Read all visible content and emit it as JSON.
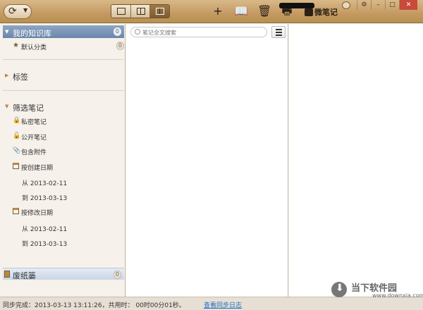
{
  "toolbar": {
    "sync_icon": "sync-icon",
    "view_modes": [
      "single-pane",
      "two-pane",
      "three-pane"
    ],
    "active_view": "three-pane",
    "actions": [
      {
        "name": "new-note-icon",
        "glyph": "+"
      },
      {
        "name": "notebook-icon",
        "glyph": "📖"
      },
      {
        "name": "trash-icon",
        "glyph": "🗑"
      },
      {
        "name": "print-icon",
        "glyph": "🖶"
      }
    ],
    "brand_text": "微笔记",
    "window_buttons": [
      "⚙",
      "–",
      "□",
      "✕"
    ]
  },
  "sidebar": {
    "kb_title": "我的知识库",
    "kb_count": "0",
    "default_category": "默认分类",
    "default_count": "0",
    "tags_title": "标签",
    "filter_title": "筛选笔记",
    "filters": {
      "private": "私密笔记",
      "public": "公开笔记",
      "attachments": "包含附件",
      "created_date": "按创建日期",
      "created_from": "从  2013-02-11",
      "created_to": "到  2013-03-13",
      "modified_date": "按修改日期",
      "modified_from": "从  2013-02-11",
      "modified_to": "到  2013-03-13"
    },
    "trash_title": "废纸篓",
    "trash_count": "0"
  },
  "notelist": {
    "search_placeholder": "笔记全文搜索"
  },
  "statusbar": {
    "text": "同步完成：2013-03-13  13:11:26，共用时：  00时00分01秒。",
    "log_link": "查看同步日志"
  },
  "watermark": {
    "title": "当下软件园",
    "url": "www.downxia.com"
  },
  "colors": {
    "toolbar": "#c49a62",
    "selected": "#6a86aa",
    "accent": "#b98940",
    "link": "#1a6fc9"
  }
}
